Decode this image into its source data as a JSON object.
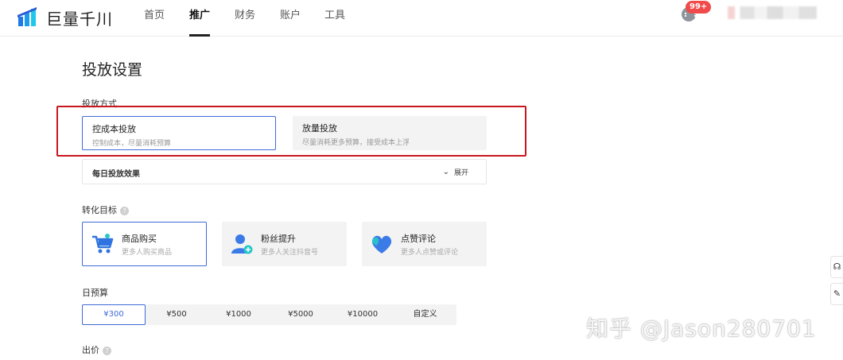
{
  "app": {
    "logo_text": "巨量千川"
  },
  "nav": {
    "items": [
      "首页",
      "推广",
      "财务",
      "账户",
      "工具"
    ],
    "active": "推广"
  },
  "header": {
    "badge": "99+"
  },
  "page": {
    "title": "投放设置"
  },
  "delivery": {
    "label": "投放方式",
    "options": [
      {
        "title": "控成本投放",
        "desc": "控制成本，尽量消耗预算",
        "selected": true
      },
      {
        "title": "放量投放",
        "desc": "尽量消耗更多预算，接受成本上浮",
        "selected": false
      }
    ]
  },
  "daily_effect": {
    "title": "每日投放效果",
    "expand_label": "展开"
  },
  "goal": {
    "label": "转化目标",
    "options": [
      {
        "title": "商品购买",
        "desc": "更多人购买商品",
        "icon": "cart-icon",
        "selected": true
      },
      {
        "title": "粉丝提升",
        "desc": "更多人关注抖音号",
        "icon": "user-plus-icon",
        "selected": false
      },
      {
        "title": "点赞评论",
        "desc": "更多人点赞或评论",
        "icon": "heart-icon",
        "selected": false
      }
    ]
  },
  "budget": {
    "label": "日预算",
    "options": [
      "¥300",
      "¥500",
      "¥1000",
      "¥5000",
      "¥10000",
      "自定义"
    ],
    "selected": "¥300"
  },
  "bid": {
    "label": "出价"
  },
  "watermark": "知乎 @Jason280701",
  "colors": {
    "accent": "#3f6ad8",
    "highlight_border": "#c8171e",
    "badge": "#f04a4a"
  }
}
